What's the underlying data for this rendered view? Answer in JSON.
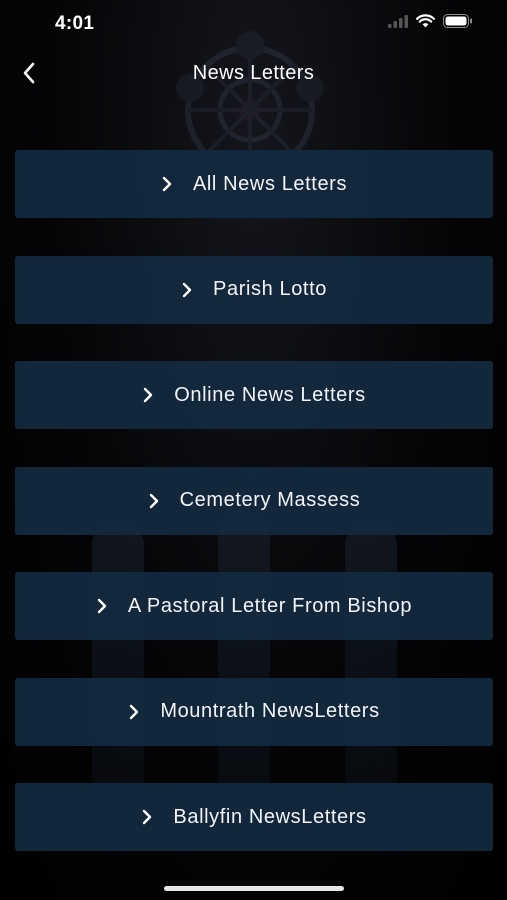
{
  "status_bar": {
    "time": "4:01",
    "icons": [
      "signal-icon",
      "wifi-icon",
      "battery-icon"
    ]
  },
  "nav": {
    "back_icon": "chevron-left-icon",
    "title": "News Letters"
  },
  "list": {
    "items": [
      {
        "label": "All News Letters"
      },
      {
        "label": "Parish Lotto"
      },
      {
        "label": "Online News Letters"
      },
      {
        "label": "Cemetery Massess"
      },
      {
        "label": "A Pastoral Letter From Bishop"
      },
      {
        "label": "Mountrath NewsLetters"
      },
      {
        "label": "Ballyfin NewsLetters"
      }
    ]
  },
  "colors": {
    "background": "#000000",
    "item_background": "#132a40",
    "text": "#ffffff"
  }
}
